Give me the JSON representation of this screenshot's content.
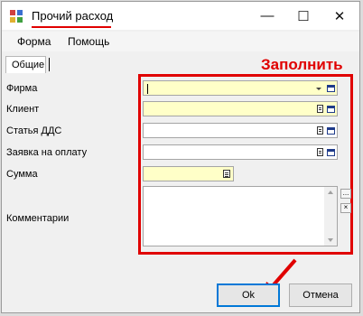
{
  "window": {
    "title": "Прочий расход",
    "minimize_glyph": "—",
    "maximize_glyph": "☐",
    "close_glyph": "✕"
  },
  "menu": {
    "items": [
      "Форма",
      "Помощь"
    ]
  },
  "tabs": [
    {
      "label": "Общие",
      "active": true
    }
  ],
  "annotation": {
    "text": "Заполнить",
    "color": "#e00000"
  },
  "form": {
    "fields": [
      {
        "label": "Фирма",
        "value": "",
        "type": "dropdown",
        "required": true
      },
      {
        "label": "Клиент",
        "value": "",
        "type": "lookup",
        "required": true
      },
      {
        "label": "Статья ДДС",
        "value": "",
        "type": "lookup",
        "required": false
      },
      {
        "label": "Заявка на оплату",
        "value": "",
        "type": "lookup",
        "required": false
      },
      {
        "label": "Сумма",
        "value": "",
        "type": "number",
        "required": true
      },
      {
        "label": "Комментарии",
        "value": "",
        "type": "memo",
        "required": false
      }
    ],
    "memo_buttons": [
      "...",
      "×"
    ]
  },
  "buttons": {
    "ok": "Ok",
    "cancel": "Отмена"
  },
  "colors": {
    "required_field_bg": "#ffffc8",
    "annotation_red": "#e00000",
    "focus_blue": "#0078d7"
  }
}
